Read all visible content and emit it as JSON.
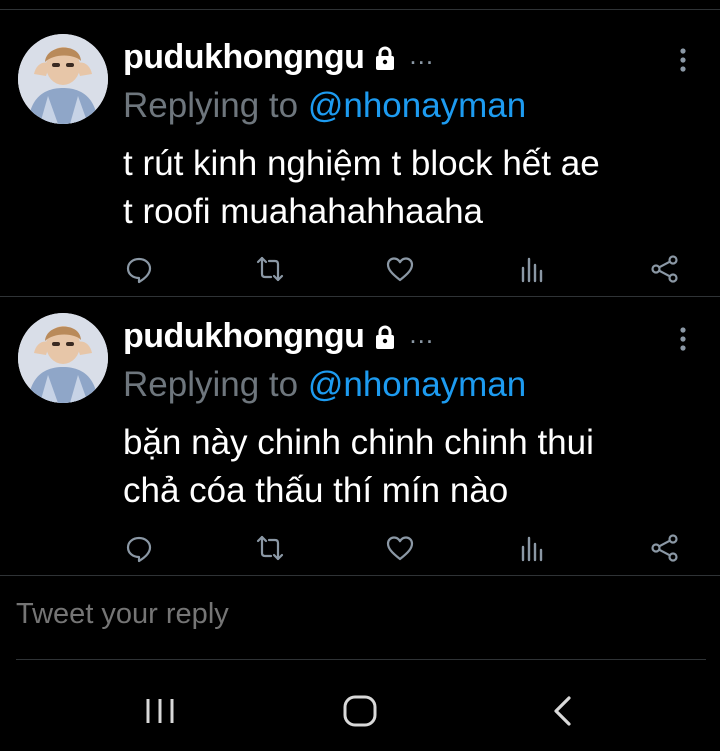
{
  "tweets": [
    {
      "name": "pudukhongngu",
      "ellipsis": "...",
      "replying_prefix": "Replying to ",
      "replying_handle": "@nhonayman",
      "text_line1": "t rút kinh nghiệm t block hết ae",
      "text_line2": "t roofi muahahahhaaha"
    },
    {
      "name": "pudukhongngu",
      "ellipsis": "...",
      "replying_prefix": "Replying to ",
      "replying_handle": "@nhonayman",
      "text_line1": "bặn này chinh chinh chinh thui",
      "text_line2": "chả cóa thấu thí mín nào"
    }
  ],
  "reply_box": {
    "placeholder": "Tweet your reply"
  },
  "icons": {
    "reply": "reply-icon",
    "retweet": "retweet-icon",
    "like": "like-icon",
    "analytics": "analytics-icon",
    "share": "share-icon",
    "lock": "lock-icon",
    "more": "more-vertical-icon",
    "nav_recent": "recent-apps-icon",
    "nav_home": "home-icon",
    "nav_back": "back-icon"
  },
  "colors": {
    "background": "#000000",
    "text": "#ffffff",
    "muted": "#6e767d",
    "link": "#1d9bf0",
    "icon": "#8b98a5",
    "divider": "#2f3336"
  }
}
